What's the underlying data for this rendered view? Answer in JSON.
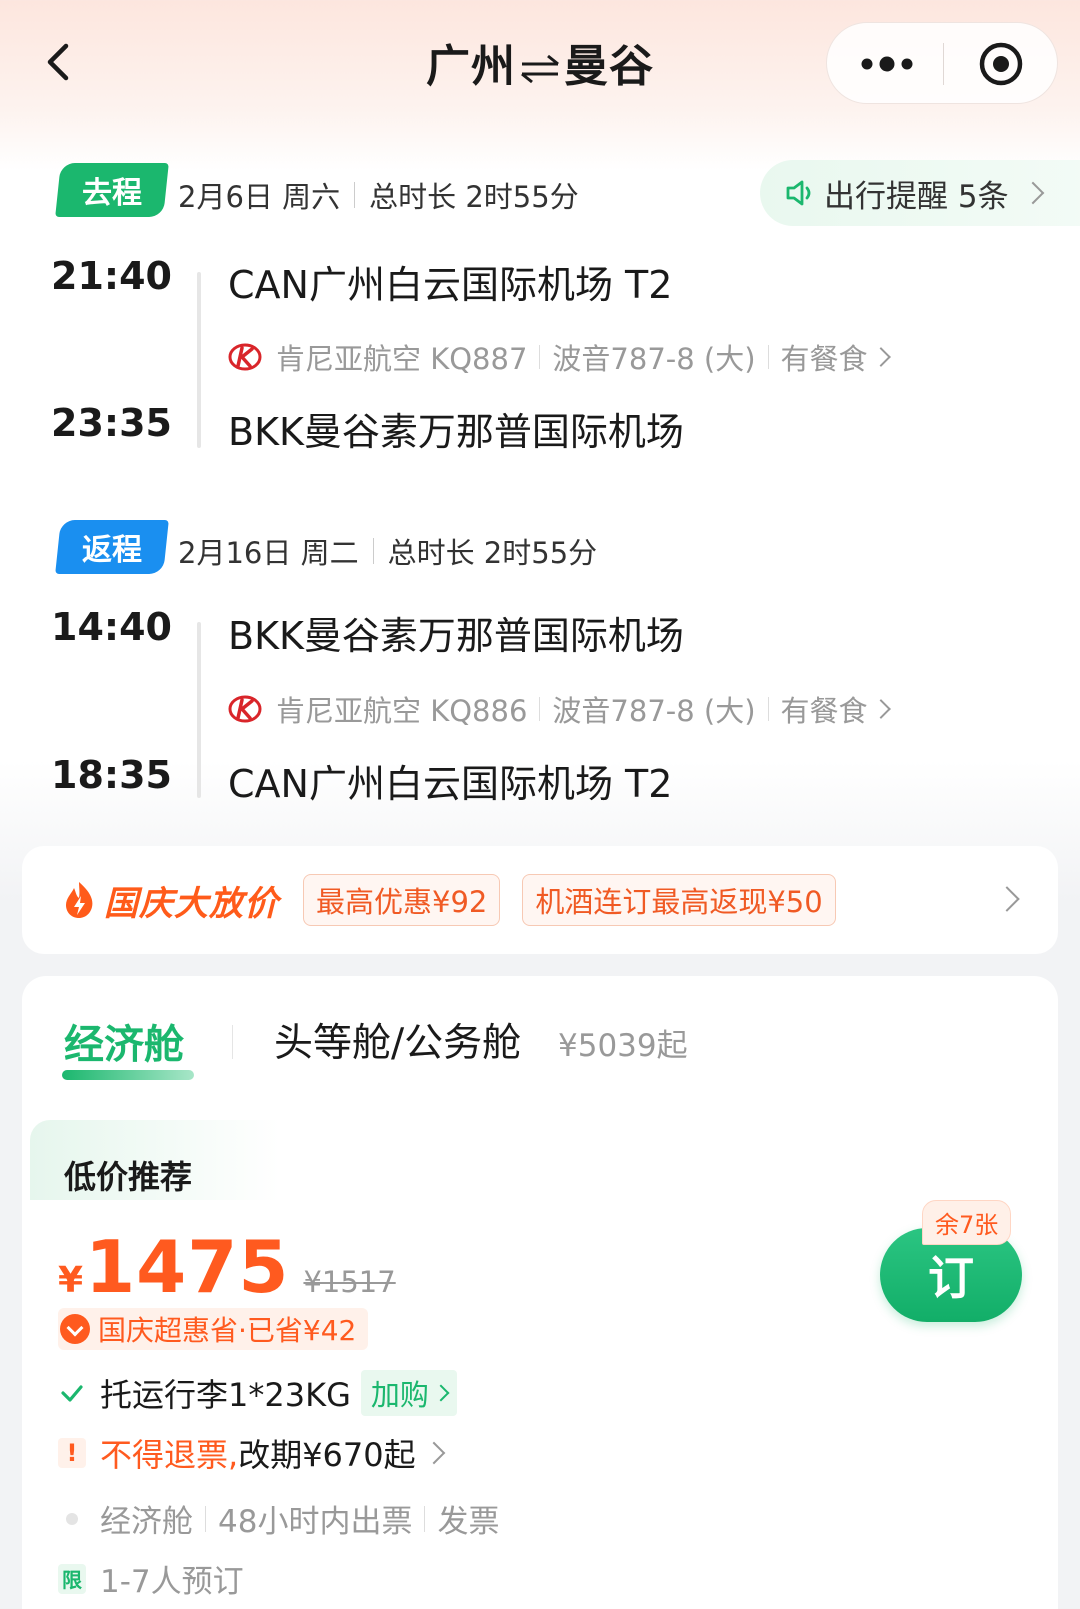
{
  "header": {
    "title_from": "广州",
    "title_to": "曼谷",
    "back_icon": "chevron-left-icon",
    "more_icon": "more-dots-icon",
    "close_icon": "target-icon"
  },
  "outbound": {
    "badge": "去程",
    "date": "2月6日 周六",
    "duration": "总时长 2时55分",
    "reminder": "出行提醒 5条",
    "dep_time": "21:40",
    "dep_airport": "CAN广州白云国际机场 T2",
    "airline": "肯尼亚航空 KQ887",
    "aircraft": "波音787-8 (大)",
    "meal": "有餐食",
    "arr_time": "23:35",
    "arr_airport": "BKK曼谷素万那普国际机场"
  },
  "return": {
    "badge": "返程",
    "date": "2月16日 周二",
    "duration": "总时长 2时55分",
    "dep_time": "14:40",
    "dep_airport": "BKK曼谷素万那普国际机场",
    "airline": "肯尼亚航空 KQ886",
    "aircraft": "波音787-8 (大)",
    "meal": "有餐食",
    "arr_time": "18:35",
    "arr_airport": "CAN广州白云国际机场 T2"
  },
  "promo": {
    "brand": "国庆大放价",
    "tag1": "最高优惠¥92",
    "tag2": "机酒连订最高返现¥50"
  },
  "cabin": {
    "tab_economy": "经济舱",
    "tab_first": "头等舱/公务舱",
    "tab_first_price": "¥5039起",
    "section_title": "低价推荐",
    "currency": "¥",
    "price": "1475",
    "old_price": "¥1517",
    "savings": "国庆超惠省·已省¥42",
    "baggage": "托运行李1*23KG",
    "addbuy": "加购",
    "refund_warning": "不得退票,",
    "change_fee": "改期¥670起",
    "class": "经济舱",
    "ticketing": "48小时内出票",
    "invoice": "发票",
    "limit_badge": "限",
    "limit_text": "1-7人预订",
    "book_button": "订",
    "remaining": "余7张"
  },
  "colors": {
    "green": "#1bb76e",
    "blue": "#1a8ff0",
    "orange": "#ff5a1f"
  }
}
